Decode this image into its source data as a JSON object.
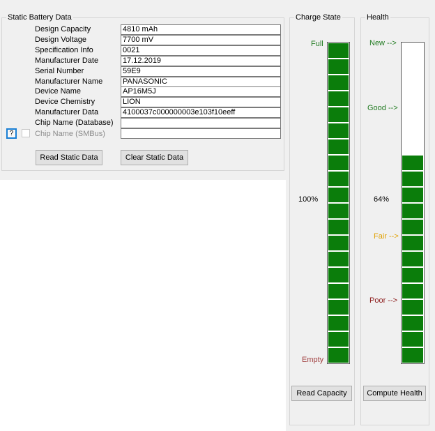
{
  "static_data": {
    "group_title": "Static Battery Data",
    "fields": [
      {
        "label": "Design Capacity",
        "value": "4810 mAh"
      },
      {
        "label": "Design Voltage",
        "value": "7700 mV"
      },
      {
        "label": "Specification Info",
        "value": "0021"
      },
      {
        "label": "Manufacturer Date",
        "value": "17.12.2019"
      },
      {
        "label": "Serial Number",
        "value": "59E9"
      },
      {
        "label": "Manufacturer Name",
        "value": "PANASONIC"
      },
      {
        "label": "Device Name",
        "value": "AP16M5J"
      },
      {
        "label": "Device Chemistry",
        "value": "LION"
      },
      {
        "label": "Manufacturer Data",
        "value": "4100037c000000003e103f10eeff"
      },
      {
        "label": "Chip Name (Database)",
        "value": ""
      },
      {
        "label": "Chip Name (SMBus)",
        "value": ""
      }
    ],
    "help_label": "?",
    "read_button": "Read Static Data",
    "clear_button": "Clear Static Data"
  },
  "charge": {
    "group_title": "Charge State",
    "full_label": "Full",
    "empty_label": "Empty",
    "percent_text": "100%",
    "level_percent": 100,
    "button": "Read Capacity",
    "full_color": "#1f7a1f",
    "empty_color": "#a14040"
  },
  "health": {
    "group_title": "Health",
    "new_label": "New -->",
    "good_label": "Good -->",
    "fair_label": "Fair -->",
    "poor_label": "Poor -->",
    "percent_text": "64%",
    "level_percent": 64,
    "button": "Compute Health",
    "new_color": "#1f7a1f",
    "good_color": "#1f7a1f",
    "fair_color": "#e0a000",
    "poor_color": "#8b1a1a"
  },
  "gauge_color": "#0b7d0b"
}
